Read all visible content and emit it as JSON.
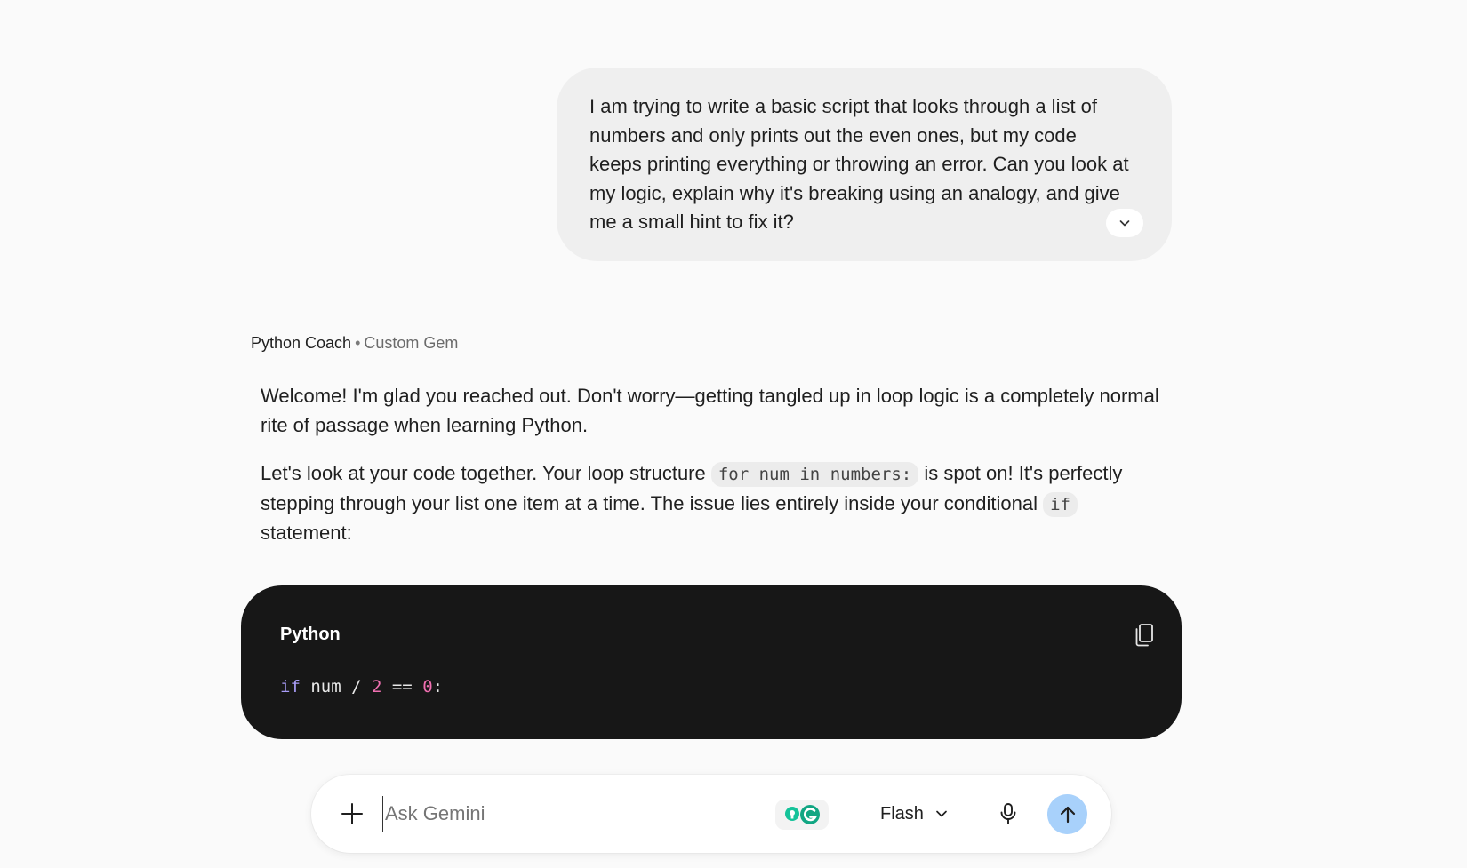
{
  "user_message": {
    "text": "I am trying to write a basic script that looks through a list of numbers and only prints out the even ones, but my code keeps printing everything or throwing an error. Can you look at my logic, explain why it's breaking using an analogy, and give me a small hint to fix it?"
  },
  "gem": {
    "name": "Python Coach",
    "separator": "•",
    "type": "Custom Gem"
  },
  "response": {
    "p1": "Welcome! I'm glad you reached out. Don't worry—getting tangled up in loop logic is a completely normal rite of passage when learning Python.",
    "p2_before": "Let's look at your code together. Your loop structure ",
    "p2_code1": "for num in numbers:",
    "p2_middle": " is spot on! It's perfectly stepping through your list one item at a time. The issue lies entirely inside your conditional ",
    "p2_code2": "if",
    "p2_after": " statement:"
  },
  "code_block": {
    "language": "Python",
    "tokens": {
      "kw": "if",
      "t1": " num / ",
      "n1": "2",
      "t2": " == ",
      "n2": "0",
      "t3": ":"
    }
  },
  "input_bar": {
    "placeholder": "Ask Gemini",
    "model": "Flash"
  },
  "icons": {
    "expand": "chevron-down-icon",
    "copy": "copy-icon",
    "add": "plus-icon",
    "mic": "microphone-icon",
    "send": "arrow-up-icon",
    "extension": "grammarly-extension-icon"
  },
  "colors": {
    "background": "#fafafa",
    "user_bubble": "#efefef",
    "code_bg": "#171717",
    "keyword": "#a89cf7",
    "number": "#f06fb1",
    "send_button": "#a8d1fb"
  }
}
